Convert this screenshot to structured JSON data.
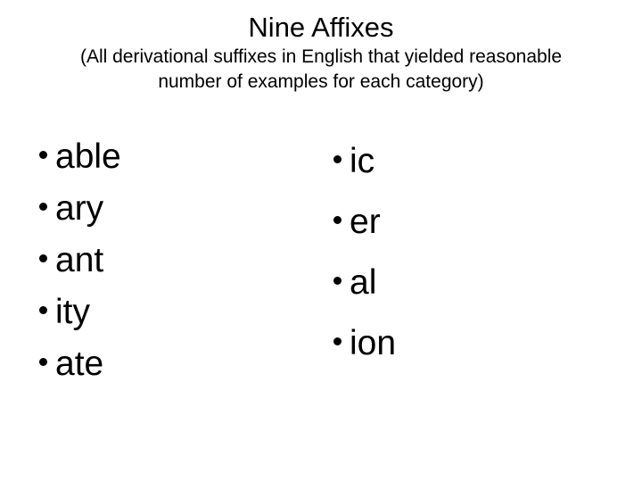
{
  "slide": {
    "title": "Nine Affixes",
    "subtitle_lines": [
      "(All derivational suffixes in English that yielded reasonable",
      "number of examples for each category)"
    ],
    "columns": [
      {
        "name": "left-column",
        "items": [
          {
            "bullet": "bullet-dot",
            "label": "able"
          },
          {
            "bullet": "bullet-dot",
            "label": "ary"
          },
          {
            "bullet": "bullet-dot",
            "label": "ant"
          },
          {
            "bullet": "bullet-dot",
            "label": "ity"
          },
          {
            "bullet": "bullet-dot",
            "label": "ate"
          }
        ]
      },
      {
        "name": "right-column",
        "items": [
          {
            "bullet": "bullet-dot",
            "label": "ic"
          },
          {
            "bullet": "bullet-dot",
            "label": "er"
          },
          {
            "bullet": "bullet-dot",
            "label": "al"
          },
          {
            "bullet": "bullet-dot",
            "label": "ion"
          }
        ]
      }
    ]
  },
  "colors": {
    "background": "#ffffff",
    "text": "#000000"
  }
}
